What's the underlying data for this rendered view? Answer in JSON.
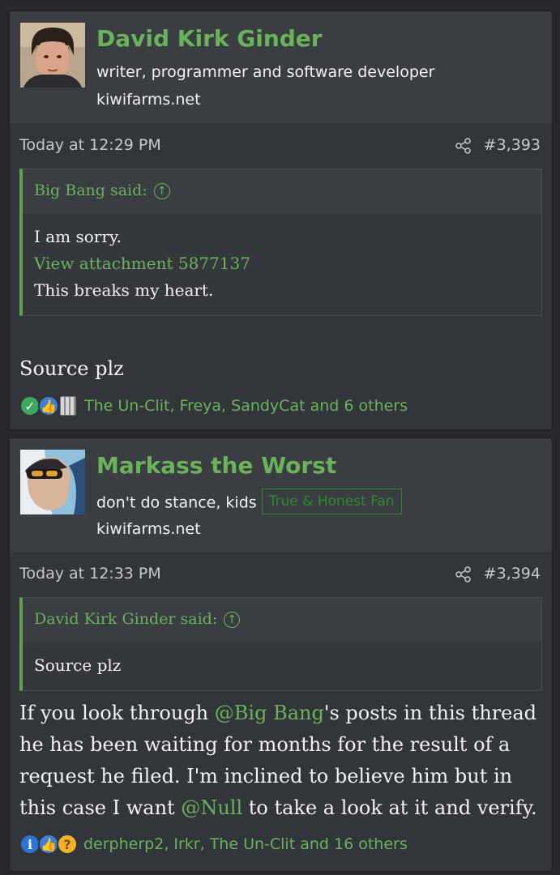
{
  "posts": [
    {
      "username": "David Kirk Ginder",
      "user_title": "writer, programmer and software developer",
      "user_site": "kiwifarms.net",
      "date": "Today at 12:29 PM",
      "post_number": "#3,393",
      "quote": {
        "header": "Big Bang said:",
        "lines": [
          "I am sorry."
        ],
        "attachment_link": "View attachment 5877137",
        "lines_after": [
          "This breaks my heart."
        ]
      },
      "message": "Source plz",
      "reactions": {
        "icons": [
          "check-icon",
          "thumbs-up-icon",
          "fence-icon"
        ],
        "text": "The Un-Clit, Freya, SandyCat and 6 others"
      }
    },
    {
      "username": "Markass the Worst",
      "user_title": "don't do stance, kids",
      "badge": "True & Honest Fan",
      "user_site": "kiwifarms.net",
      "date": "Today at 12:33 PM",
      "post_number": "#3,394",
      "quote": {
        "header": "David Kirk Ginder said:",
        "lines": [
          "Source plz"
        ]
      },
      "message_parts": {
        "p1": "If you look through ",
        "mention1": "@Big Bang",
        "p2": "'s posts in this thread he has been waiting for months for the result of a request he filed. I'm inclined to believe him but in this case I want ",
        "mention2": "@Null",
        "p3": " to take a look at it and verify."
      },
      "reactions": {
        "icons": [
          "informative-icon",
          "thumbs-up-icon",
          "thinking-icon"
        ],
        "text": "derpherp2, Irkr, The Un-Clit and 16 others"
      }
    }
  ],
  "colors": {
    "accent_green": "#6bb35b",
    "background": "#26282c",
    "post_bg": "#32353a"
  }
}
